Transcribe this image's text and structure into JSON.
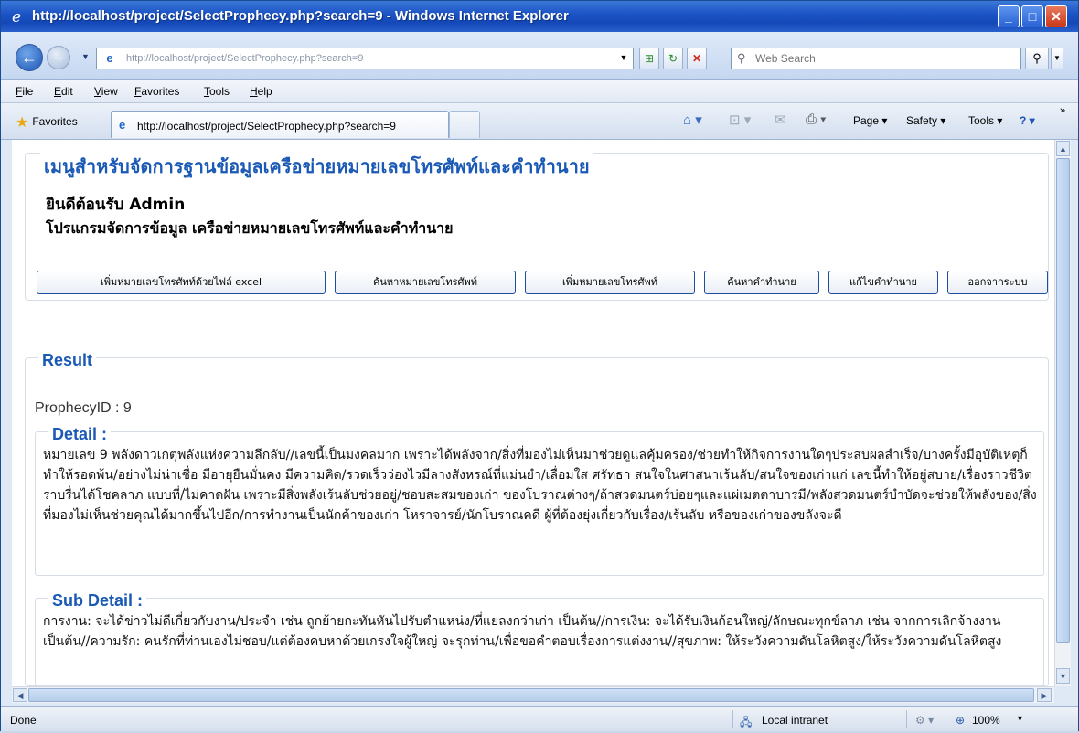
{
  "window": {
    "title": "http://localhost/project/SelectProphecy.php?search=9 - Windows Internet Explorer"
  },
  "address": {
    "url": "http://localhost/project/SelectProphecy.php?search=9"
  },
  "search": {
    "placeholder": "Web Search"
  },
  "menubar": {
    "items": [
      "File",
      "Edit",
      "View",
      "Favorites",
      "Tools",
      "Help"
    ]
  },
  "favorites_label": "Favorites",
  "tab": {
    "label": "http://localhost/project/SelectProphecy.php?search=9"
  },
  "commandbar": {
    "page": "Page",
    "safety": "Safety",
    "tools": "Tools"
  },
  "page": {
    "menu_heading": "เมนูสำหรับจัดการฐานข้อมูลเครือข่ายหมายเลขโทรศัพท์และคำทำนาย",
    "welcome": "ยินดีต้อนรับ Admin",
    "program_title": "โปรแกรมจัดการข้อมูล เครือข่ายหมายเลขโทรศัพท์และคำทำนาย",
    "buttons": [
      "เพิ่มหมายเลขโทรศัพท์ด้วยไฟล์ excel",
      "ค้นหาหมายเลขโทรศัพท์",
      "เพิ่มหมายเลขโทรศัพท์",
      "ค้นหาคำทำนาย",
      "แก้ไขคำทำนาย",
      "ออกจากระบบ"
    ],
    "result_heading": "Result",
    "prophecy_id_label": "ProphecyID : 9",
    "detail_heading": "Detail :",
    "detail_text": "หมายเลข 9 พลังดาวเกตุพลังแห่งความลึกลับ//เลขนี้เป็นมงคลมาก เพราะได้พลังจาก/สิ่งที่มองไม่เห็นมาช่วยดูแลคุ้มครอง/ช่วยทำให้กิจการงานใดๆประสบผลสำเร็จ/บางครั้งมีอุบัติเหตุก็ทำให้รอดพ้น/อย่างไม่น่าเชื่อ มีอายุยืนมั่นคง มีความคิด/รวดเร็วว่องไวมีลางสังหรณ์ที่แม่นยำ/เลื่อมใส ศรัทธา สนใจในศาสนาเร้นลับ/สนใจของเก่าแก่ เลขนี้ทำให้อยู่สบาย/เรื่องราวชีวิตราบรื่นได้โชคลาภ แบบที่/ไม่คาดฝัน เพราะมีสิ่งพลังเร้นลับช่วยอยู่/ชอบสะสมของเก่า ของโบราณต่างๆ/ถ้าสวดมนตร์บ่อยๆและแผ่เมตตาบารมี/พลังสวดมนตร์บำบัดจะช่วยให้พลังของ/สิ่งที่มองไม่เห็นช่วยคุณได้มากขึ้นไปอีก/การทำงานเป็นนักค้าของเก่า โหราจารย์/นักโบราณคดี ผู้ที่ต้องยุ่งเกี่ยวกับเรื่อง/เร้นลับ หรือของเก่าของขลังจะดี",
    "subdetail_heading": "Sub Detail :",
    "subdetail_text": "การงาน: จะได้ข่าวไม่ดีเกี่ยวกับงาน/ประจำ เช่น ถูกย้ายกะทันหันไปรับตำแหน่ง/ที่แย่ลงกว่าเก่า เป็นต้น//การเงิน: จะได้รับเงินก้อนใหญ่/ลักษณะทุกข์ลาภ เช่น จากการเลิกจ้างงาน เป็นต้น//ความรัก: คนรักที่ท่านเองไม่ชอบ/แต่ต้องคบหาด้วยเกรงใจผู้ใหญ่ จะรุกท่าน/เพื่อขอคำตอบเรื่องการแต่งงาน//สุขภาพ: ให้ระวังความดันโลหิตสูง/ให้ระวังความดันโลหิตสูง"
  },
  "status": {
    "left": "Done",
    "zone": "Local intranet",
    "zoom": "100%"
  }
}
